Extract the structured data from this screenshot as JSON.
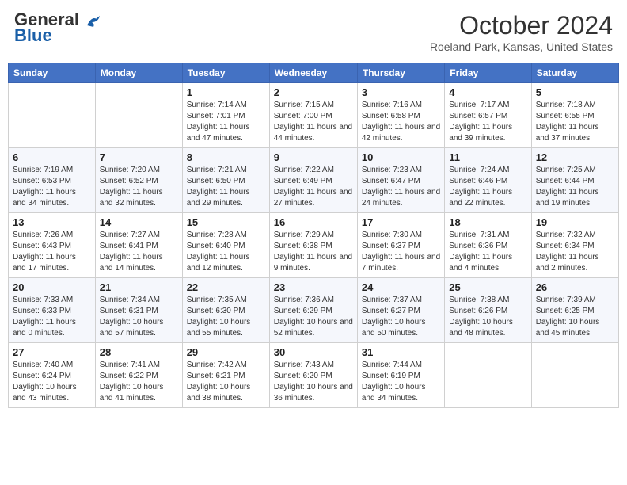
{
  "header": {
    "logo_line1": "General",
    "logo_line2": "Blue",
    "month_title": "October 2024",
    "location": "Roeland Park, Kansas, United States"
  },
  "days_of_week": [
    "Sunday",
    "Monday",
    "Tuesday",
    "Wednesday",
    "Thursday",
    "Friday",
    "Saturday"
  ],
  "weeks": [
    [
      {
        "day": "",
        "info": ""
      },
      {
        "day": "",
        "info": ""
      },
      {
        "day": "1",
        "info": "Sunrise: 7:14 AM\nSunset: 7:01 PM\nDaylight: 11 hours and 47 minutes."
      },
      {
        "day": "2",
        "info": "Sunrise: 7:15 AM\nSunset: 7:00 PM\nDaylight: 11 hours and 44 minutes."
      },
      {
        "day": "3",
        "info": "Sunrise: 7:16 AM\nSunset: 6:58 PM\nDaylight: 11 hours and 42 minutes."
      },
      {
        "day": "4",
        "info": "Sunrise: 7:17 AM\nSunset: 6:57 PM\nDaylight: 11 hours and 39 minutes."
      },
      {
        "day": "5",
        "info": "Sunrise: 7:18 AM\nSunset: 6:55 PM\nDaylight: 11 hours and 37 minutes."
      }
    ],
    [
      {
        "day": "6",
        "info": "Sunrise: 7:19 AM\nSunset: 6:53 PM\nDaylight: 11 hours and 34 minutes."
      },
      {
        "day": "7",
        "info": "Sunrise: 7:20 AM\nSunset: 6:52 PM\nDaylight: 11 hours and 32 minutes."
      },
      {
        "day": "8",
        "info": "Sunrise: 7:21 AM\nSunset: 6:50 PM\nDaylight: 11 hours and 29 minutes."
      },
      {
        "day": "9",
        "info": "Sunrise: 7:22 AM\nSunset: 6:49 PM\nDaylight: 11 hours and 27 minutes."
      },
      {
        "day": "10",
        "info": "Sunrise: 7:23 AM\nSunset: 6:47 PM\nDaylight: 11 hours and 24 minutes."
      },
      {
        "day": "11",
        "info": "Sunrise: 7:24 AM\nSunset: 6:46 PM\nDaylight: 11 hours and 22 minutes."
      },
      {
        "day": "12",
        "info": "Sunrise: 7:25 AM\nSunset: 6:44 PM\nDaylight: 11 hours and 19 minutes."
      }
    ],
    [
      {
        "day": "13",
        "info": "Sunrise: 7:26 AM\nSunset: 6:43 PM\nDaylight: 11 hours and 17 minutes."
      },
      {
        "day": "14",
        "info": "Sunrise: 7:27 AM\nSunset: 6:41 PM\nDaylight: 11 hours and 14 minutes."
      },
      {
        "day": "15",
        "info": "Sunrise: 7:28 AM\nSunset: 6:40 PM\nDaylight: 11 hours and 12 minutes."
      },
      {
        "day": "16",
        "info": "Sunrise: 7:29 AM\nSunset: 6:38 PM\nDaylight: 11 hours and 9 minutes."
      },
      {
        "day": "17",
        "info": "Sunrise: 7:30 AM\nSunset: 6:37 PM\nDaylight: 11 hours and 7 minutes."
      },
      {
        "day": "18",
        "info": "Sunrise: 7:31 AM\nSunset: 6:36 PM\nDaylight: 11 hours and 4 minutes."
      },
      {
        "day": "19",
        "info": "Sunrise: 7:32 AM\nSunset: 6:34 PM\nDaylight: 11 hours and 2 minutes."
      }
    ],
    [
      {
        "day": "20",
        "info": "Sunrise: 7:33 AM\nSunset: 6:33 PM\nDaylight: 11 hours and 0 minutes."
      },
      {
        "day": "21",
        "info": "Sunrise: 7:34 AM\nSunset: 6:31 PM\nDaylight: 10 hours and 57 minutes."
      },
      {
        "day": "22",
        "info": "Sunrise: 7:35 AM\nSunset: 6:30 PM\nDaylight: 10 hours and 55 minutes."
      },
      {
        "day": "23",
        "info": "Sunrise: 7:36 AM\nSunset: 6:29 PM\nDaylight: 10 hours and 52 minutes."
      },
      {
        "day": "24",
        "info": "Sunrise: 7:37 AM\nSunset: 6:27 PM\nDaylight: 10 hours and 50 minutes."
      },
      {
        "day": "25",
        "info": "Sunrise: 7:38 AM\nSunset: 6:26 PM\nDaylight: 10 hours and 48 minutes."
      },
      {
        "day": "26",
        "info": "Sunrise: 7:39 AM\nSunset: 6:25 PM\nDaylight: 10 hours and 45 minutes."
      }
    ],
    [
      {
        "day": "27",
        "info": "Sunrise: 7:40 AM\nSunset: 6:24 PM\nDaylight: 10 hours and 43 minutes."
      },
      {
        "day": "28",
        "info": "Sunrise: 7:41 AM\nSunset: 6:22 PM\nDaylight: 10 hours and 41 minutes."
      },
      {
        "day": "29",
        "info": "Sunrise: 7:42 AM\nSunset: 6:21 PM\nDaylight: 10 hours and 38 minutes."
      },
      {
        "day": "30",
        "info": "Sunrise: 7:43 AM\nSunset: 6:20 PM\nDaylight: 10 hours and 36 minutes."
      },
      {
        "day": "31",
        "info": "Sunrise: 7:44 AM\nSunset: 6:19 PM\nDaylight: 10 hours and 34 minutes."
      },
      {
        "day": "",
        "info": ""
      },
      {
        "day": "",
        "info": ""
      }
    ]
  ]
}
